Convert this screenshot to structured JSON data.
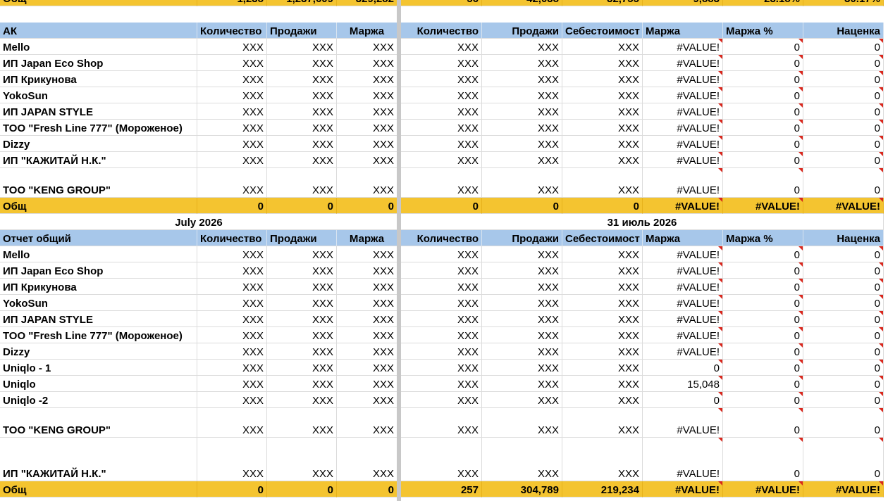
{
  "top_partial": {
    "name": "Общ",
    "left": [
      "1,238",
      "1,237,609",
      "329,282"
    ],
    "right": [
      "56",
      "42,038",
      "32,755",
      "9,883",
      "23.18%",
      "30.17%"
    ]
  },
  "section1": {
    "header_left": [
      "АК",
      "Количество",
      "Продажи",
      "Маржа"
    ],
    "header_right": [
      "Количество",
      "Продажи",
      "Себестоимост",
      "Маржа",
      "Маржа %",
      "Наценка"
    ],
    "rows": [
      {
        "name": "Mello",
        "v": [
          "XXX",
          "XXX",
          "XXX",
          "XXX",
          "XXX",
          "XXX",
          "#VALUE!",
          "0",
          "0"
        ]
      },
      {
        "name": "ИП Japan Eco Shop",
        "v": [
          "XXX",
          "XXX",
          "XXX",
          "XXX",
          "XXX",
          "XXX",
          "#VALUE!",
          "0",
          "0"
        ]
      },
      {
        "name": "ИП Крикунова",
        "v": [
          "XXX",
          "XXX",
          "XXX",
          "XXX",
          "XXX",
          "XXX",
          "#VALUE!",
          "0",
          "0"
        ]
      },
      {
        "name": "YokoSun",
        "v": [
          "XXX",
          "XXX",
          "XXX",
          "XXX",
          "XXX",
          "XXX",
          "#VALUE!",
          "0",
          "0"
        ]
      },
      {
        "name": "ИП JAPAN STYLE",
        "v": [
          "XXX",
          "XXX",
          "XXX",
          "XXX",
          "XXX",
          "XXX",
          "#VALUE!",
          "0",
          "0"
        ]
      },
      {
        "name": "ТОО \"Fresh Line 777\" (Мороженое)",
        "v": [
          "XXX",
          "XXX",
          "XXX",
          "XXX",
          "XXX",
          "XXX",
          "#VALUE!",
          "0",
          "0"
        ]
      },
      {
        "name": "Dizzy",
        "v": [
          "XXX",
          "XXX",
          "XXX",
          "XXX",
          "XXX",
          "XXX",
          "#VALUE!",
          "0",
          "0"
        ]
      },
      {
        "name": "ИП \"КАЖИТАЙ Н.К.\"",
        "v": [
          "XXX",
          "XXX",
          "XXX",
          "XXX",
          "XXX",
          "XXX",
          "#VALUE!",
          "0",
          "0"
        ]
      },
      {
        "name": "ТОО \"KENG GROUP\"",
        "v": [
          "XXX",
          "XXX",
          "XXX",
          "XXX",
          "XXX",
          "XXX",
          "#VALUE!",
          "0",
          "0"
        ]
      }
    ],
    "total": {
      "name": "Общ",
      "v": [
        "0",
        "0",
        "0",
        "0",
        "0",
        "0",
        "#VALUE!",
        "#VALUE!",
        "#VALUE!"
      ]
    }
  },
  "section2": {
    "title_left": "July 2026",
    "title_right": "31 июль 2026",
    "header_left": [
      "Отчет общий",
      "Количество",
      "Продажи",
      "Маржа"
    ],
    "header_right": [
      "Количество",
      "Продажи",
      "Себестоимост",
      "Маржа",
      "Маржа %",
      "Наценка"
    ],
    "rows": [
      {
        "name": "Mello",
        "v": [
          "XXX",
          "XXX",
          "XXX",
          "XXX",
          "XXX",
          "XXX",
          "#VALUE!",
          "0",
          "0"
        ]
      },
      {
        "name": "ИП Japan Eco Shop",
        "v": [
          "XXX",
          "XXX",
          "XXX",
          "XXX",
          "XXX",
          "XXX",
          "#VALUE!",
          "0",
          "0"
        ]
      },
      {
        "name": "ИП Крикунова",
        "v": [
          "XXX",
          "XXX",
          "XXX",
          "XXX",
          "XXX",
          "XXX",
          "#VALUE!",
          "0",
          "0"
        ]
      },
      {
        "name": "YokoSun",
        "v": [
          "XXX",
          "XXX",
          "XXX",
          "XXX",
          "XXX",
          "XXX",
          "#VALUE!",
          "0",
          "0"
        ]
      },
      {
        "name": "ИП JAPAN STYLE",
        "v": [
          "XXX",
          "XXX",
          "XXX",
          "XXX",
          "XXX",
          "XXX",
          "#VALUE!",
          "0",
          "0"
        ]
      },
      {
        "name": "ТОО \"Fresh Line 777\" (Мороженое)",
        "v": [
          "XXX",
          "XXX",
          "XXX",
          "XXX",
          "XXX",
          "XXX",
          "#VALUE!",
          "0",
          "0"
        ]
      },
      {
        "name": "Dizzy",
        "v": [
          "XXX",
          "XXX",
          "XXX",
          "XXX",
          "XXX",
          "XXX",
          "#VALUE!",
          "0",
          "0"
        ]
      },
      {
        "name": "Uniqlo - 1",
        "v": [
          "XXX",
          "XXX",
          "XXX",
          "XXX",
          "XXX",
          "XXX",
          "0",
          "0",
          "0"
        ]
      },
      {
        "name": "Uniqlo",
        "v": [
          "XXX",
          "XXX",
          "XXX",
          "XXX",
          "XXX",
          "XXX",
          "15,048",
          "0",
          "0"
        ]
      },
      {
        "name": "Uniqlo -2",
        "v": [
          "XXX",
          "XXX",
          "XXX",
          "XXX",
          "XXX",
          "XXX",
          "0",
          "0",
          "0"
        ]
      },
      {
        "name": "ТОО \"KENG GROUP\"",
        "v": [
          "XXX",
          "XXX",
          "XXX",
          "XXX",
          "XXX",
          "XXX",
          "#VALUE!",
          "0",
          "0"
        ]
      },
      {
        "name": "ИП \"КАЖИТАЙ Н.К.\"",
        "v": [
          "XXX",
          "XXX",
          "XXX",
          "XXX",
          "XXX",
          "XXX",
          "#VALUE!",
          "0",
          "0"
        ]
      }
    ],
    "total": {
      "name": "Общ",
      "v": [
        "0",
        "0",
        "0",
        "257",
        "304,789",
        "219,234",
        "#VALUE!",
        "#VALUE!",
        "#VALUE!"
      ]
    }
  },
  "colors": {
    "header": "#a7c7ea",
    "total": "#f4c430",
    "comment_flag": "#d9261c"
  }
}
